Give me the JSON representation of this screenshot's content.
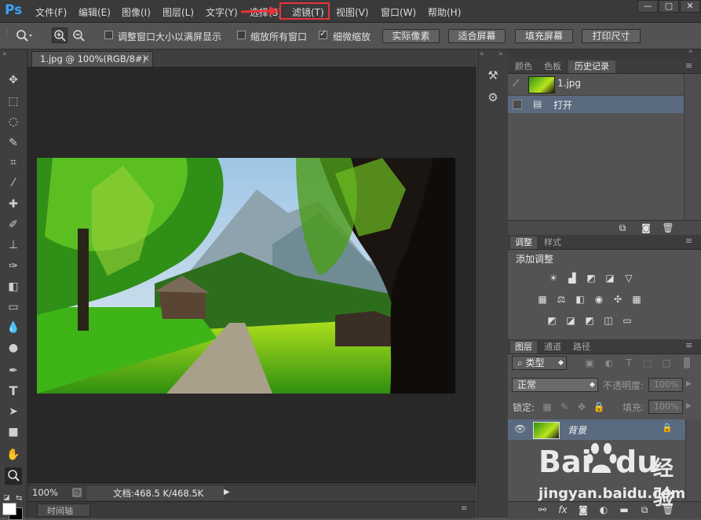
{
  "app": {
    "logo": "Ps"
  },
  "menu": [
    "文件(F)",
    "编辑(E)",
    "图像(I)",
    "图层(L)",
    "文字(Y)",
    "选择(S)",
    "滤镜(T)",
    "视图(V)",
    "窗口(W)",
    "帮助(H)"
  ],
  "window_controls": {
    "minimize": "—",
    "maximize": "▢",
    "close": "✕"
  },
  "options": {
    "resize_windows": "调整窗口大小以满屏显示",
    "zoom_all": "缩放所有窗口",
    "scrubby_zoom": "细微缩放",
    "actual_pixels": "实际像素",
    "fit_screen": "适合屏幕",
    "fill_screen": "填充屏幕",
    "print_size": "打印尺寸"
  },
  "document": {
    "tab_title": "1.jpg @ 100%(RGB/8#)",
    "tab_close": "×"
  },
  "status": {
    "zoom": "100%",
    "doc_info": "文档:468.5 K/468.5K"
  },
  "timeline": {
    "label": "时间轴"
  },
  "history_panel": {
    "tabs": [
      "颜色",
      "色板",
      "历史记录"
    ],
    "snapshot": "1.jpg",
    "step": "打开"
  },
  "adjustments_panel": {
    "tabs": [
      "调整",
      "样式"
    ],
    "title": "添加调整"
  },
  "layers_panel": {
    "tabs": [
      "图层",
      "通道",
      "路径"
    ],
    "filter_kind": "类型",
    "blend_mode": "正常",
    "opacity_label": "不透明度:",
    "opacity_value": "100%",
    "lock_label": "锁定:",
    "fill_label": "填充:",
    "fill_value": "100%",
    "layer_name": "背景"
  },
  "watermark": {
    "brand": "Bai",
    "brand2": "du",
    "sub": "经验",
    "url": "jingyan.baidu.com"
  },
  "colors": {
    "accent_blue": "#38a3ff",
    "highlight_red": "#e8333a",
    "selection": "#5a6b80"
  }
}
